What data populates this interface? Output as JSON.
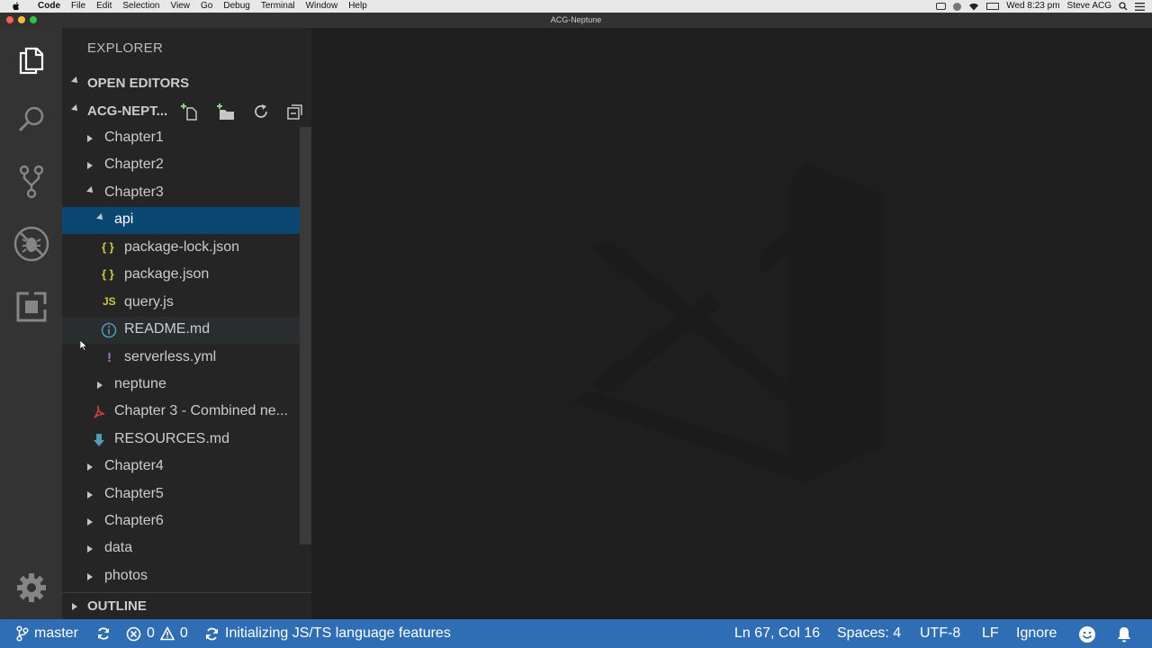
{
  "menubar": {
    "app_name": "Code",
    "menus": [
      "File",
      "Edit",
      "Selection",
      "View",
      "Go",
      "Debug",
      "Terminal",
      "Window",
      "Help"
    ],
    "clock": "Wed 8:23 pm",
    "user": "Steve ACG"
  },
  "window": {
    "title": "ACG-Neptune"
  },
  "activity_bar": [
    "files-icon",
    "search-icon",
    "source-control-icon",
    "debug-icon",
    "extensions-icon",
    "gear-icon"
  ],
  "sidebar": {
    "title": "EXPLORER",
    "open_editors": "OPEN EDITORS",
    "folder": "ACG-NEPT...",
    "outline": "OUTLINE",
    "tree": [
      {
        "label": "Chapter1"
      },
      {
        "label": "Chapter2"
      },
      {
        "label": "Chapter3"
      },
      {
        "label": "api"
      },
      {
        "label": "package-lock.json",
        "icon": "{ }"
      },
      {
        "label": "package.json",
        "icon": "{ }"
      },
      {
        "label": "query.js",
        "icon": "JS"
      },
      {
        "label": "README.md"
      },
      {
        "label": "serverless.yml",
        "icon": "!"
      },
      {
        "label": "neptune"
      },
      {
        "label": "Chapter 3 - Combined ne..."
      },
      {
        "label": "RESOURCES.md"
      },
      {
        "label": "Chapter4"
      },
      {
        "label": "Chapter5"
      },
      {
        "label": "Chapter6"
      },
      {
        "label": "data"
      },
      {
        "label": "photos"
      }
    ]
  },
  "statusbar": {
    "branch": "master",
    "errors": "0",
    "warnings": "0",
    "task": "Initializing JS/TS language features",
    "position": "Ln 67, Col 16",
    "spaces": "Spaces: 4",
    "encoding": "UTF-8",
    "eol": "LF",
    "ignore": "Ignore"
  },
  "colors": {
    "statusbar": "#2f6db5",
    "selection": "#094771",
    "json_icon": "#cbcb41",
    "js_icon": "#cbcb41",
    "yml_icon": "#a074c4",
    "info_icon": "#519aba",
    "pdf_icon": "#cc3e44",
    "md_icon": "#519aba"
  }
}
